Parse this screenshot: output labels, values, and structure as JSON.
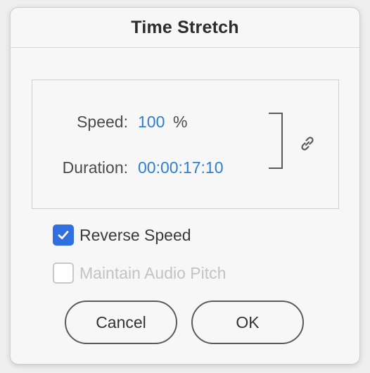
{
  "dialog": {
    "title": "Time Stretch"
  },
  "speed": {
    "label": "Speed:",
    "value": "100",
    "unit": "%"
  },
  "duration": {
    "label": "Duration:",
    "value": "00:00:17:10"
  },
  "link": {
    "icon": "link-icon"
  },
  "options": {
    "reverse_speed": {
      "label": "Reverse Speed",
      "checked": true
    },
    "maintain_audio_pitch": {
      "label": "Maintain Audio Pitch",
      "checked": false,
      "disabled": true
    }
  },
  "buttons": {
    "cancel": "Cancel",
    "ok": "OK"
  },
  "colors": {
    "value_blue": "#2b7fd6",
    "checkbox_blue": "#2f6fe0"
  }
}
